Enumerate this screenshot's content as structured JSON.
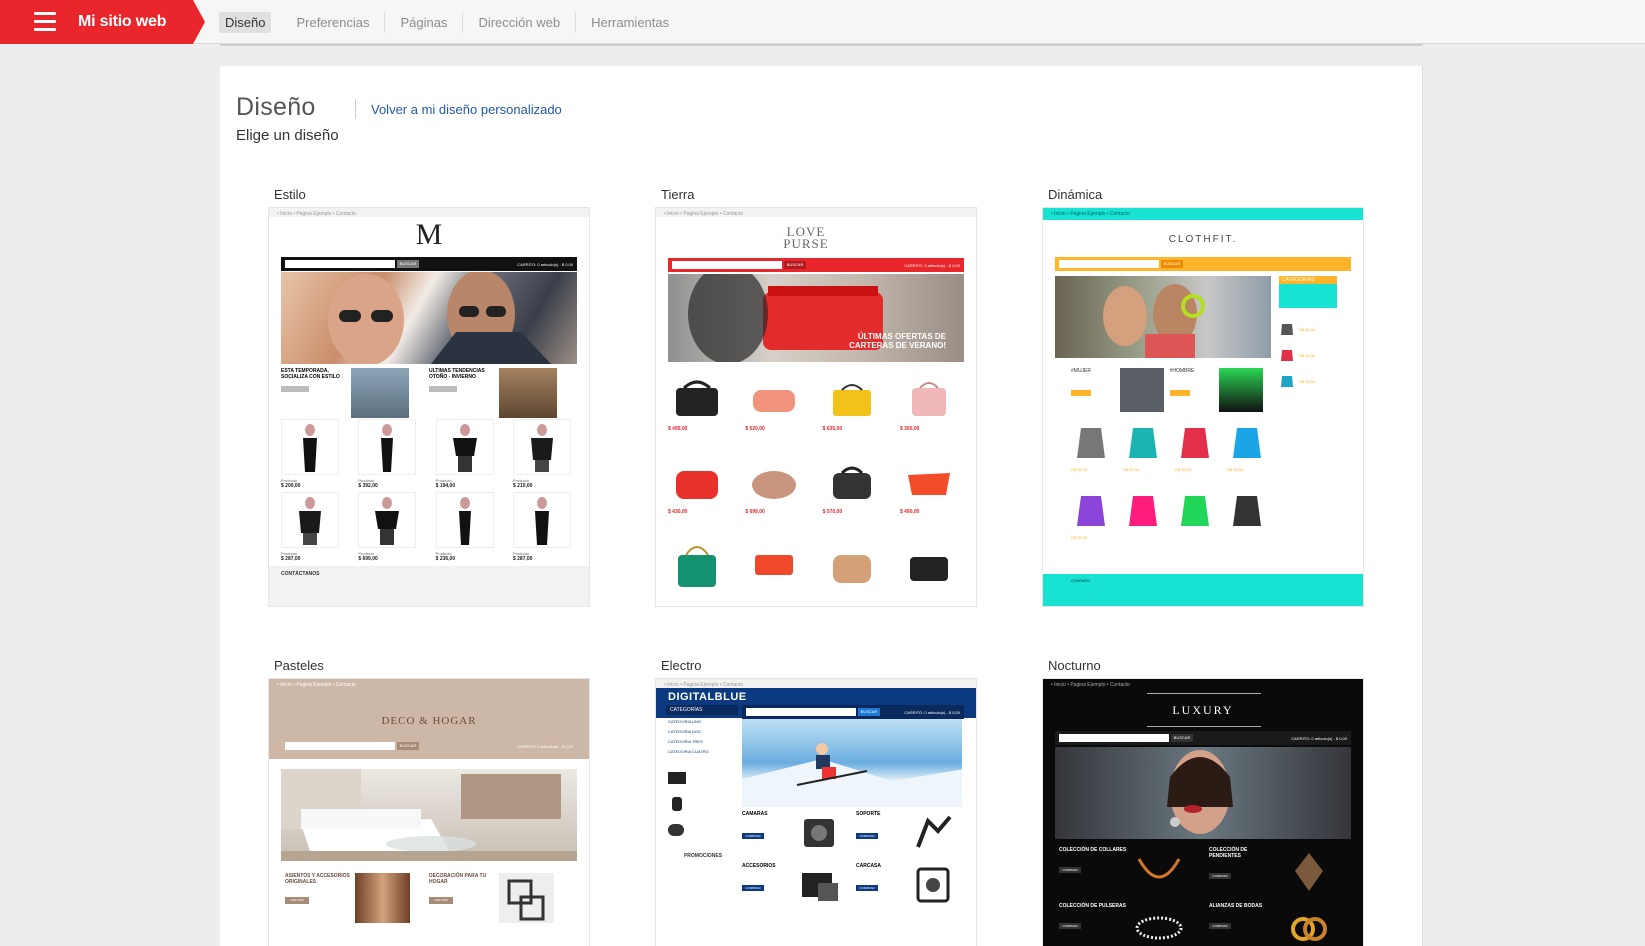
{
  "app": {
    "title": "Mi sitio web",
    "brand_color": "#e8262c"
  },
  "nav": {
    "items": [
      {
        "label": "Diseño",
        "active": true
      },
      {
        "label": "Preferencias",
        "active": false
      },
      {
        "label": "Páginas",
        "active": false
      },
      {
        "label": "Dirección web",
        "active": false
      },
      {
        "label": "Herramientas",
        "active": false
      }
    ]
  },
  "page": {
    "title": "Diseño",
    "back_link": "Volver a mi diseño personalizado",
    "subtitle": "Elige un diseño",
    "link_color": "#2458a9"
  },
  "designs": [
    {
      "name": "Estilo",
      "crumbs": "• Inicio  • Pagina Ejemplo  • Contacto",
      "logo": "M",
      "cart": "CARRITO: 0 articulo(s) - $ 0,00",
      "search_btn": "BUSCAR",
      "promos": [
        "ESTA TEMPORADA, SOCIALIZA CON ESTILO",
        "ULTIMAS TENDENCIAS OTOÑO - INVIERNO"
      ],
      "product_label": "Producto",
      "prices": [
        "$ 200,00",
        "$ 392,00",
        "$ 194,00",
        "$ 210,00",
        "$ 287,00",
        "$ 699,00",
        "$ 236,00",
        "$ 287,00"
      ],
      "footer": "CONTÁCTANOS",
      "accent": "#111111"
    },
    {
      "name": "Tierra",
      "crumbs": "• Inicio  • Pagina Ejemplo  • Contacto",
      "logo": "LOVE PURSE",
      "cart": "CARRITO: 0 articulo(s) - $ 0,00",
      "search_btn": "BUSCAR",
      "banner": "ÚLTIMAS OFERTAS DE CARTERAS DE VERANO!",
      "prices": [
        "$ 499,00",
        "$ 520,00",
        "$ 635,00",
        "$ 300,00",
        "$ 430,00",
        "$ 699,00",
        "$ 570,00",
        "$ 490,00"
      ],
      "accent": "#e8262c"
    },
    {
      "name": "Dinámica",
      "crumbs": "• Inicio  • Pagina Ejemplo  • Contacto",
      "logo": "CLOTHFIT.",
      "search_btn": "BUSCAR",
      "categories_label": "CATEGORIAS",
      "tags": [
        "#MUJER",
        "#HOMBRE"
      ],
      "shop_btn": "VER MÁS",
      "prices": [
        "R$ 84,00",
        "R$ 45,00",
        "R$ 35,00",
        "R$ 85,00",
        "R$ 90,00",
        "R$ 45,00",
        "R$ 35,00",
        "R$ 36,00"
      ],
      "footer": "CONTATO",
      "accent": "#18e3d3",
      "accent2": "#ffb529"
    },
    {
      "name": "Pasteles",
      "crumbs": "• Inicio  • Pagina Ejemplo  • Contacto",
      "logo": "DECO & HOGAR",
      "search_btn": "BUSCAR",
      "cart": "CARRITO: 0 articulo(s) - $ 0,00",
      "promos": [
        "ASIENTOS Y ACCESORIOS ORIGINALES",
        "DECORACIÓN PARA TU HOGAR"
      ],
      "more_btn": "VER MÁS",
      "accent": "#cdb7a6"
    },
    {
      "name": "Electro",
      "crumbs": "• Inicio  • Pagina Ejemplo  • Contacto",
      "logo": "DIGITALBLUE",
      "categories_label": "CATEGORÍAS",
      "categories": [
        "CATEGORIA UNO",
        "CATEGORIA DOS",
        "CATEGORIA TRES",
        "CATEGORIA CUATRO"
      ],
      "search_btn": "BUSCAR",
      "cart": "CARRITO: 0 articulo(s) - $ 0,00",
      "promos_label": "PROMOCIONES",
      "features": [
        "CAMARAS",
        "SOPORTE",
        "ACCESORIOS",
        "CARCASA"
      ],
      "buy_btn": "COMPRAR",
      "accent": "#0c3a80"
    },
    {
      "name": "Nocturno",
      "crumbs": "• Inicio  • Pagina Ejemplo  • Contacto",
      "logo": "LUXURY",
      "search_btn": "BUSCAR",
      "cart": "CARRITO: 0 articulo(s) - $ 0,00",
      "features": [
        "COLECCIÓN DE COLLARES",
        "COLECCIÓN DE PENDIENTES",
        "COLECCIÓN DE PULSERAS",
        "ALIANZAS DE BODAS"
      ],
      "buy_btn": "COMPRAR",
      "accent": "#0a0a0a"
    }
  ]
}
